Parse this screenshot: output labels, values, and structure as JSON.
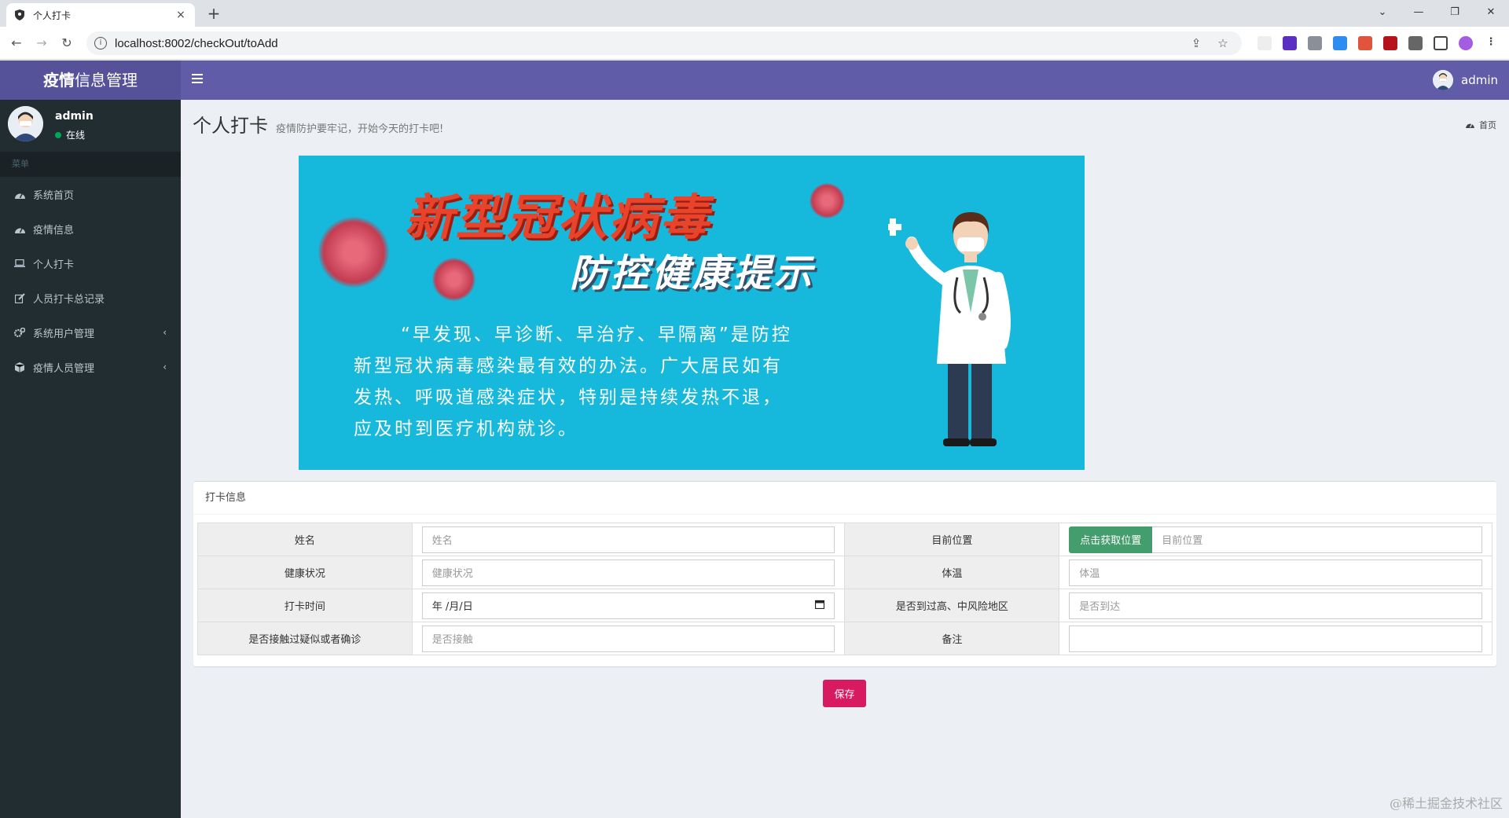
{
  "browser": {
    "tab_title": "个人打卡",
    "tab_close": "×",
    "new_tab": "+",
    "url": "localhost:8002/checkOut/toAdd",
    "window_controls": [
      "⌄",
      "—",
      "❐",
      "✕"
    ]
  },
  "header": {
    "logo_bold": "疫情",
    "logo_rest": "信息管理",
    "user": "admin"
  },
  "sidebar": {
    "user_name": "admin",
    "status": "在线",
    "menu_header": "菜单",
    "items": [
      {
        "label": "系统首页",
        "icon": "dashboard-icon",
        "has_arrow": false
      },
      {
        "label": "疫情信息",
        "icon": "dashboard-icon",
        "has_arrow": false
      },
      {
        "label": "个人打卡",
        "icon": "laptop-icon",
        "has_arrow": false
      },
      {
        "label": "人员打卡总记录",
        "icon": "edit-icon",
        "has_arrow": false
      },
      {
        "label": "系统用户管理",
        "icon": "gears-icon",
        "has_arrow": true
      },
      {
        "label": "疫情人员管理",
        "icon": "cube-icon",
        "has_arrow": true
      }
    ],
    "arrow": "‹"
  },
  "content": {
    "title": "个人打卡",
    "subtitle": "疫情防护要牢记，开始今天的打卡吧!",
    "breadcrumb": "首页"
  },
  "banner": {
    "title1": "新型冠状病毒",
    "title2": "防控健康提示",
    "text": "“早发现、早诊断、早治疗、早隔离”是防控新型冠状病毒感染最有效的办法。广大居民如有发热、呼吸道感染症状，特别是持续发热不退，应及时到医疗机构就诊。"
  },
  "form": {
    "box_title": "打卡信息",
    "rows": [
      {
        "label1": "姓名",
        "ph1": "姓名",
        "label2": "目前位置",
        "ph2": "目前位置"
      },
      {
        "label1": "健康状况",
        "ph1": "健康状况",
        "label2": "体温",
        "ph2": "体温"
      },
      {
        "label1": "打卡时间",
        "ph1": "年 /月/日",
        "label2": "是否到过高、中风险地区",
        "ph2": "是否到达"
      },
      {
        "label1": "是否接触过疑似或者确诊",
        "ph1": "是否接触",
        "label2": "备注",
        "ph2": ""
      }
    ],
    "location_button": "点击获取位置",
    "save_button": "保存"
  },
  "watermark": "@稀土掘金技术社区",
  "colors": {
    "header": "#605ca8",
    "logo_bg": "#555299",
    "sidebar": "#222d32",
    "save": "#d81b60",
    "location_button": "#449d6c",
    "banner": "#16b9db"
  }
}
